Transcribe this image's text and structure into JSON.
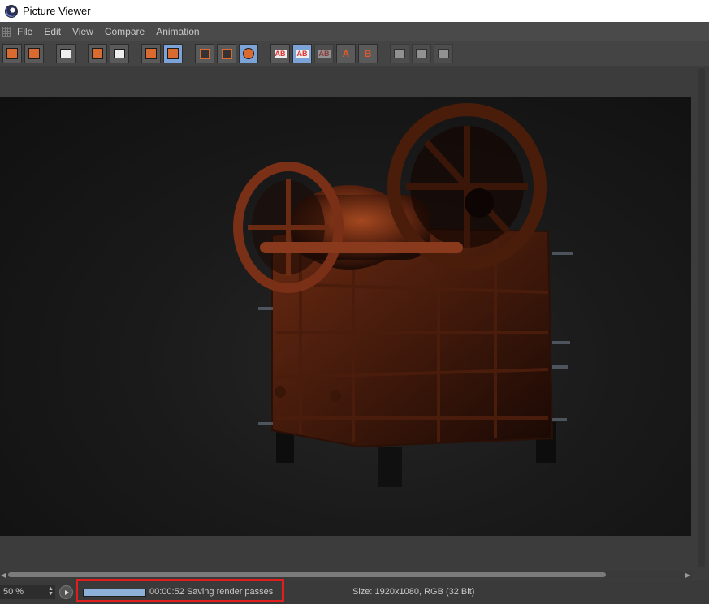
{
  "window": {
    "title": "Picture Viewer"
  },
  "menu": {
    "items": [
      "File",
      "Edit",
      "View",
      "Compare",
      "Animation"
    ]
  },
  "toolbar": {
    "groups": [
      {
        "buttons": [
          {
            "icon": "open-folder-icon"
          },
          {
            "icon": "save-icon"
          }
        ]
      },
      {
        "buttons": [
          {
            "icon": "clapboard-icon"
          }
        ]
      },
      {
        "buttons": [
          {
            "icon": "render-region-icon"
          },
          {
            "icon": "user-export-icon"
          }
        ]
      },
      {
        "buttons": [
          {
            "icon": "copy-icon"
          },
          {
            "icon": "paste-icon",
            "active": true
          }
        ]
      },
      {
        "buttons": [
          {
            "icon": "view-a-icon"
          },
          {
            "icon": "view-b-icon"
          },
          {
            "icon": "view-channels-icon"
          }
        ]
      },
      {
        "buttons": [
          {
            "icon": "ab-compare-icon",
            "label": "AB"
          },
          {
            "icon": "ab-split-icon",
            "label": "AB",
            "active": true
          },
          {
            "icon": "ab-diff-icon",
            "label": "AB",
            "dim": true
          }
        ]
      },
      {
        "buttons": [
          {
            "icon": "set-a-icon",
            "label": "A"
          },
          {
            "icon": "set-b-icon",
            "label": "B"
          }
        ]
      },
      {
        "buttons": [
          {
            "icon": "compare-1-icon",
            "dim": true
          },
          {
            "icon": "compare-2-icon",
            "dim": true
          },
          {
            "icon": "compare-3-icon",
            "dim": true
          }
        ]
      }
    ]
  },
  "viewer": {
    "image_desc": "render"
  },
  "status": {
    "zoom": "50 %",
    "progress": 1.0,
    "message": "00:00:52 Saving render passes",
    "size_info": "Size: 1920x1080, RGB (32 Bit)"
  },
  "colors": {
    "accent": "#7ca3d8",
    "highlight": "#e01e1e",
    "machine": "#8a3a1c"
  }
}
